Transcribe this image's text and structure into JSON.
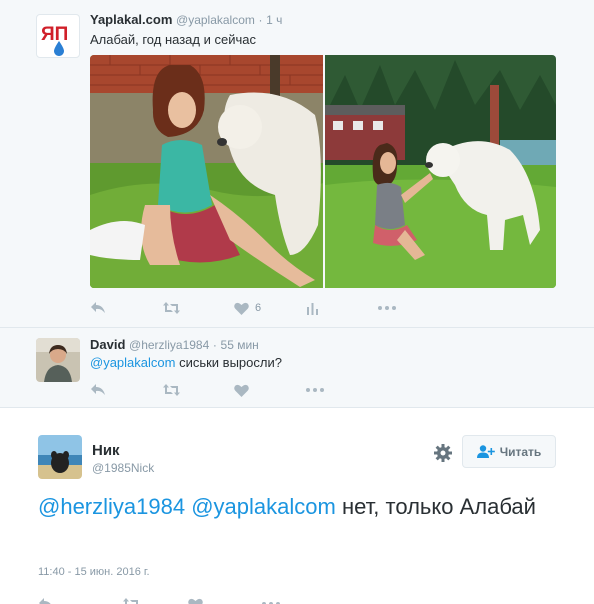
{
  "tweet1": {
    "avatar_text": "ЯП",
    "name": "Yaplakal.com",
    "handle": "@yaplakalcom",
    "sep": "·",
    "time": "1 ч",
    "text": "Алабай, год назад и сейчас",
    "like_count": "6",
    "icons": [
      "reply-icon",
      "retweet-icon",
      "heart-icon",
      "analytics-icon",
      "more-icon"
    ]
  },
  "tweet2": {
    "name": "David",
    "handle": "@herzliya1984",
    "sep": "·",
    "time": "55 мин",
    "mention": "@yaplakalcom",
    "text": "сиськи выросли?",
    "icons": [
      "reply-icon",
      "retweet-icon",
      "heart-icon",
      "more-icon"
    ]
  },
  "tweet3": {
    "name": "Ник",
    "handle": "@1985Nick",
    "follow_label": "Читать",
    "mention1": "@herzliya1984",
    "mention2": "@yaplakalcom",
    "text": "нет, только Алабай",
    "timestamp": "11:40 - 15 июн. 2016 г.",
    "icons": [
      "gear-icon",
      "follow-icon"
    ]
  },
  "colors": {
    "link": "#1b95e0",
    "action_icon": "#aab8c2",
    "secondary_text": "#8899a6",
    "background_conversation": "#f5f8fa"
  }
}
